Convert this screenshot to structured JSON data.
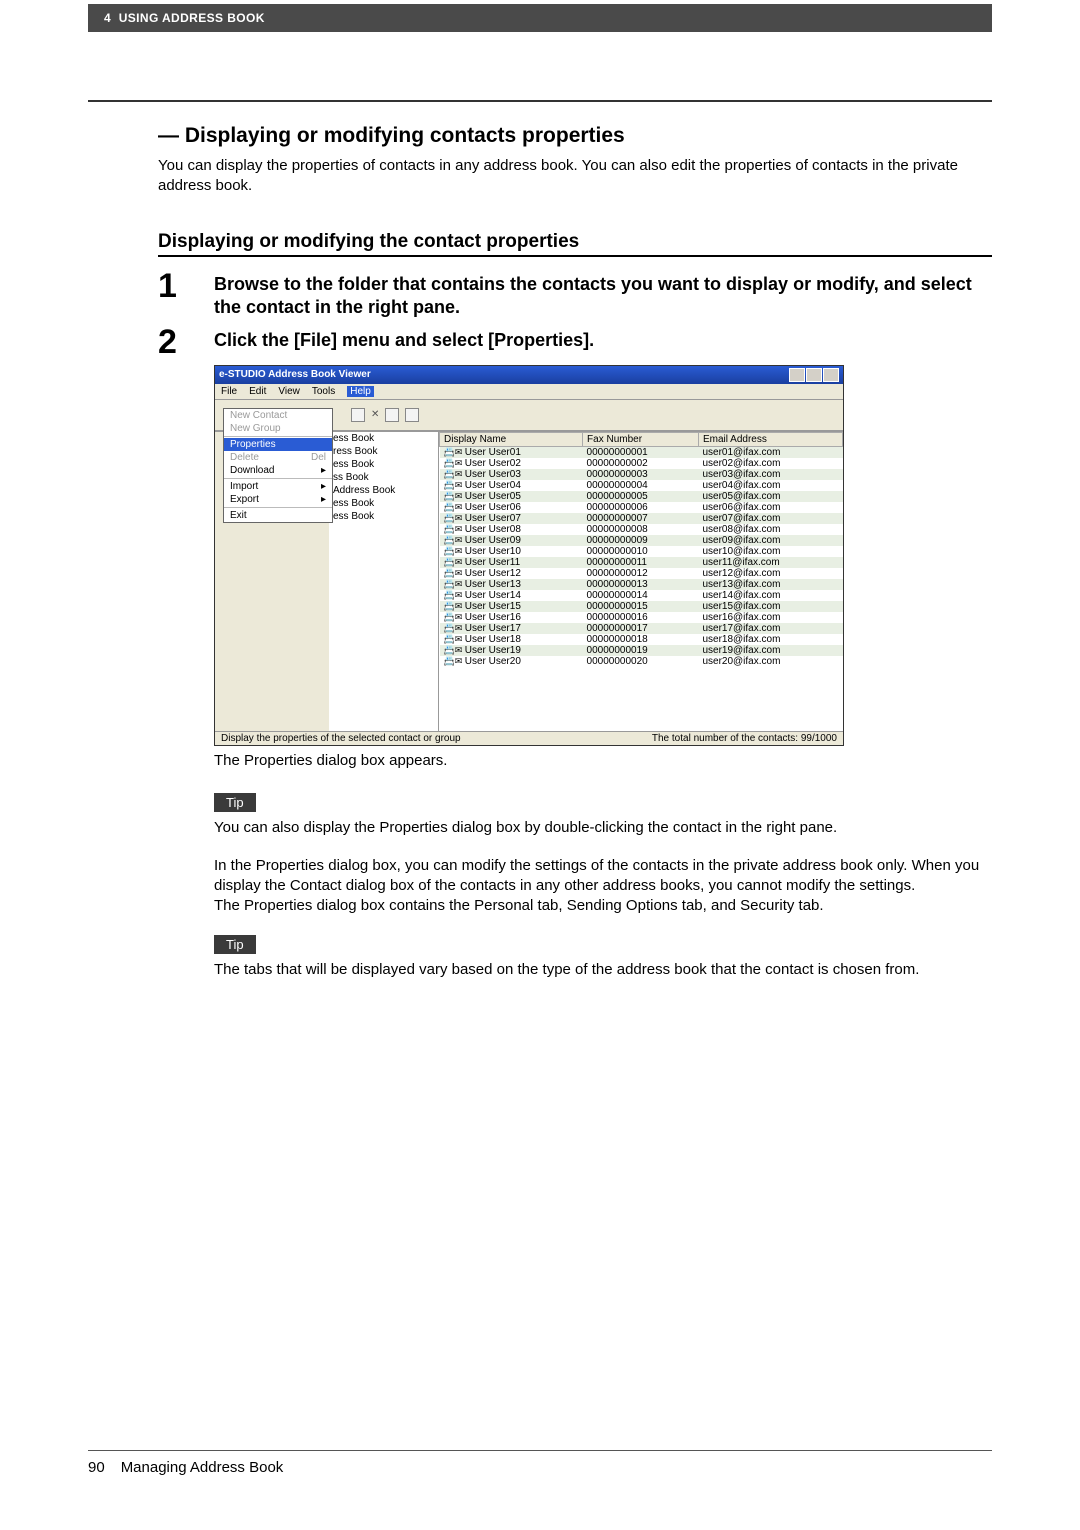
{
  "header": {
    "chapterNumber": "4",
    "chapterTitle": "USING ADDRESS BOOK"
  },
  "section": {
    "title": "— Displaying or modifying contacts properties",
    "body": "You can display the properties of contacts in any address book. You can also edit the properties of contacts in the private address book."
  },
  "subsection": {
    "title": "Displaying or modifying the contact properties"
  },
  "steps": {
    "s1": {
      "num": "1",
      "text": "Browse to the folder that contains the contacts you want to display or modify, and select the contact in the right pane."
    },
    "s2": {
      "num": "2",
      "text": "Click the [File] menu and select [Properties]."
    }
  },
  "screenshot": {
    "windowTitle": "e-STUDIO Address Book Viewer",
    "menubar": [
      "File",
      "Edit",
      "View",
      "Tools",
      "Help"
    ],
    "fileMenu": [
      {
        "label": "New Contact",
        "enabled": false
      },
      {
        "label": "New Group",
        "enabled": false
      },
      {
        "sep": true
      },
      {
        "label": "Properties",
        "selected": true
      },
      {
        "label": "Delete",
        "shortcut": "Del",
        "enabled": false
      },
      {
        "label": "Download",
        "sub": true
      },
      {
        "sep": true
      },
      {
        "label": "Import",
        "sub": true
      },
      {
        "label": "Export",
        "sub": true
      },
      {
        "sep": true
      },
      {
        "label": "Exit"
      }
    ],
    "tree": [
      "ess Book",
      "ress Book",
      "ess Book",
      "ss Book",
      "Address Book",
      "ess Book",
      "ess Book"
    ],
    "columns": [
      "Display Name",
      "Fax Number",
      "Email Address"
    ],
    "rows": [
      [
        "User User01",
        "00000000001",
        "user01@ifax.com"
      ],
      [
        "User User02",
        "00000000002",
        "user02@ifax.com"
      ],
      [
        "User User03",
        "00000000003",
        "user03@ifax.com"
      ],
      [
        "User User04",
        "00000000004",
        "user04@ifax.com"
      ],
      [
        "User User05",
        "00000000005",
        "user05@ifax.com"
      ],
      [
        "User User06",
        "00000000006",
        "user06@ifax.com"
      ],
      [
        "User User07",
        "00000000007",
        "user07@ifax.com"
      ],
      [
        "User User08",
        "00000000008",
        "user08@ifax.com"
      ],
      [
        "User User09",
        "00000000009",
        "user09@ifax.com"
      ],
      [
        "User User10",
        "00000000010",
        "user10@ifax.com"
      ],
      [
        "User User11",
        "00000000011",
        "user11@ifax.com"
      ],
      [
        "User User12",
        "00000000012",
        "user12@ifax.com"
      ],
      [
        "User User13",
        "00000000013",
        "user13@ifax.com"
      ],
      [
        "User User14",
        "00000000014",
        "user14@ifax.com"
      ],
      [
        "User User15",
        "00000000015",
        "user15@ifax.com"
      ],
      [
        "User User16",
        "00000000016",
        "user16@ifax.com"
      ],
      [
        "User User17",
        "00000000017",
        "user17@ifax.com"
      ],
      [
        "User User18",
        "00000000018",
        "user18@ifax.com"
      ],
      [
        "User User19",
        "00000000019",
        "user19@ifax.com"
      ],
      [
        "User User20",
        "00000000020",
        "user20@ifax.com"
      ]
    ],
    "statusLeft": "Display the properties of the selected contact or group",
    "statusRight": "The total number of the contacts: 99/1000"
  },
  "caption": "The Properties dialog box appears.",
  "tipLabel": "Tip",
  "tip1": "You can also display the Properties dialog box by double-clicking the contact in the right pane.",
  "para2a": "In the Properties dialog box, you can modify the settings of the contacts in the private address book only. When you display the Contact dialog box of the contacts in any other address books, you cannot modify the settings.",
  "para2b": "The Properties dialog box contains the Personal tab, Sending Options tab, and Security tab.",
  "tip2": "The tabs that will be displayed vary based on the type of the address book that the contact is chosen from.",
  "footer": {
    "page": "90",
    "text": "Managing Address Book"
  }
}
